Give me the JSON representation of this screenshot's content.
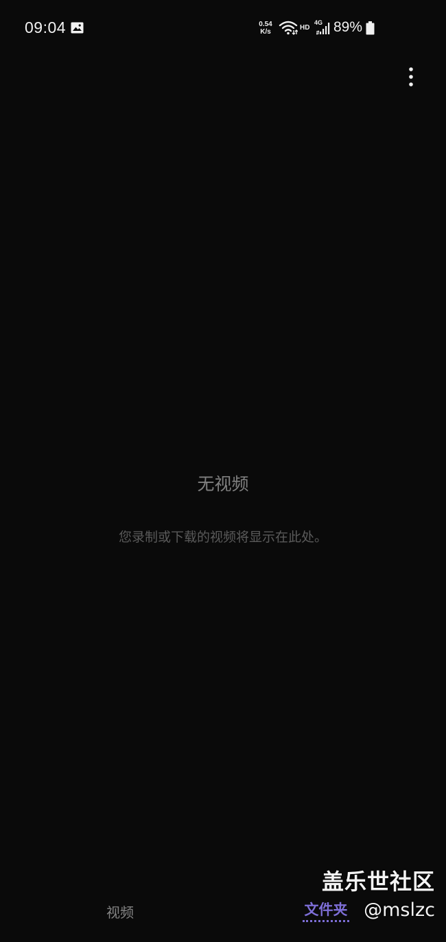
{
  "status_bar": {
    "time": "09:04",
    "net_speed_value": "0.54",
    "net_speed_unit": "K/s",
    "hd_label": "HD",
    "network_type": "4G",
    "battery_percent": "89%",
    "icons": {
      "gallery": "image-icon",
      "wifi": "wifi-icon",
      "signal": "signal-icon",
      "battery": "battery-icon"
    }
  },
  "toolbar": {
    "more_icon": "more-vertical-icon"
  },
  "empty_state": {
    "title": "无视频",
    "description": "您录制或下载的视频将显示在此处。"
  },
  "bottom_nav": {
    "tabs": [
      {
        "label": "视频",
        "selected": false
      },
      {
        "label": "文件夹",
        "selected": true
      }
    ]
  },
  "watermark": {
    "brand": "盖乐世社区",
    "handle": "@mslzc"
  },
  "colors": {
    "background": "#0a0a0a",
    "accent": "#7d6ed6",
    "text_primary": "#f2f2f2",
    "text_muted": "#808080"
  }
}
